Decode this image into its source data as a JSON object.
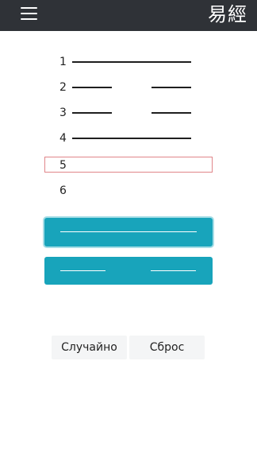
{
  "appbar": {
    "menu_icon": "hamburger-menu-icon",
    "logo_text": "易經"
  },
  "lines": [
    {
      "number": "1",
      "type": "yang",
      "selected": false
    },
    {
      "number": "2",
      "type": "yin",
      "selected": false
    },
    {
      "number": "3",
      "type": "yin",
      "selected": false
    },
    {
      "number": "4",
      "type": "yang",
      "selected": false
    },
    {
      "number": "5",
      "type": "empty",
      "selected": true
    },
    {
      "number": "6",
      "type": "empty",
      "selected": false
    }
  ],
  "choices": {
    "yang": {
      "icon": "solid-line-icon"
    },
    "yin": {
      "icon": "broken-line-icon"
    }
  },
  "actions": {
    "random_label": "Случайно",
    "reset_label": "Сброс"
  },
  "colors": {
    "appbar": "#2f3237",
    "accent": "#18a4bb",
    "selection_border": "#e0868a"
  }
}
